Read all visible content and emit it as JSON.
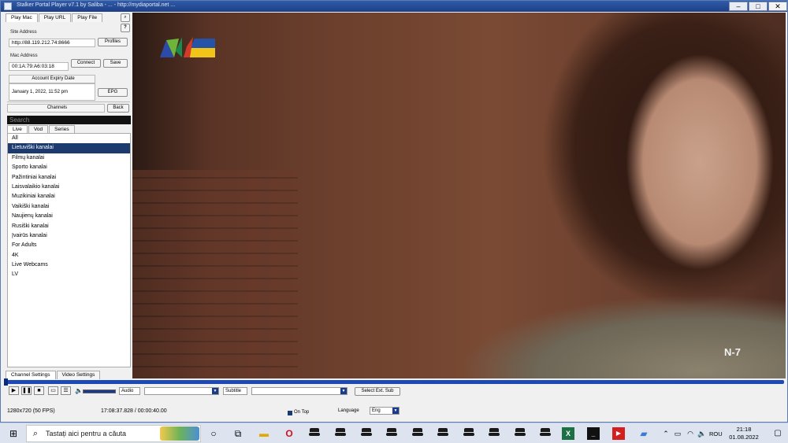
{
  "window": {
    "title": "Stalker Portal Player v7.1 by Saliba - ... - http://mydiaportal.net ...",
    "controls": {
      "minimize": "–",
      "maximize": "□",
      "close": "✕"
    }
  },
  "left_panel": {
    "top_tabs": [
      "Play Mac",
      "Play URL",
      "Play File"
    ],
    "help": "?",
    "portal_label": "Site Address",
    "portal_value": "http://88.119.212.74:8666",
    "profiles_button": "Profiles",
    "mac_label": "Mac Address",
    "mac_value": "00:1A:79:A6:03:18",
    "connect_button": "Connect",
    "save_button": "Save",
    "expiry_label": "Account Expiry Date",
    "expiry_value": "January 1, 2022, 11:52 pm",
    "epg_button": "EPG",
    "channels_label": "Channels",
    "back_button": "Back",
    "search_placeholder": "Search",
    "content_tabs": [
      "Live",
      "Vod",
      "Series"
    ],
    "categories": [
      "All",
      "Lietuviški kanalai",
      "Filmų kanalai",
      "Sporto kanalai",
      "Pažintiniai kanalai",
      "Laisvalaikio kanalai",
      "Muzikiniai kanalai",
      "Vaikiški kanalai",
      "Naujienų kanalai",
      "Rusiški kanalai",
      "Įvairūs kanalai",
      "For Adults",
      "4K",
      "Live Webcams",
      "LV"
    ],
    "selected_index": 1,
    "bottom_tabs": [
      "Channel Settings",
      "Video Settings"
    ]
  },
  "video": {
    "watermark": "N-7"
  },
  "controls": {
    "audio_label": "Audio",
    "subtitle_label": "Subtitle",
    "select_ext_sub": "Select Ext. Sub"
  },
  "status": {
    "resolution": "1280x720  (50 FPS)",
    "time": "17:08:37.828 / 00:00:40.00",
    "on_top": "On Top",
    "language_label": "Language",
    "language_value": "Eng"
  },
  "taskbar": {
    "search_placeholder": "Tastați aici pentru a căuta",
    "lang": "ROU",
    "time": "21:18",
    "date": "01.08.2022"
  },
  "colors": {
    "accent": "#1c3a6e",
    "titlebar": "#2f5ba8",
    "seek": "#1c49b5"
  }
}
